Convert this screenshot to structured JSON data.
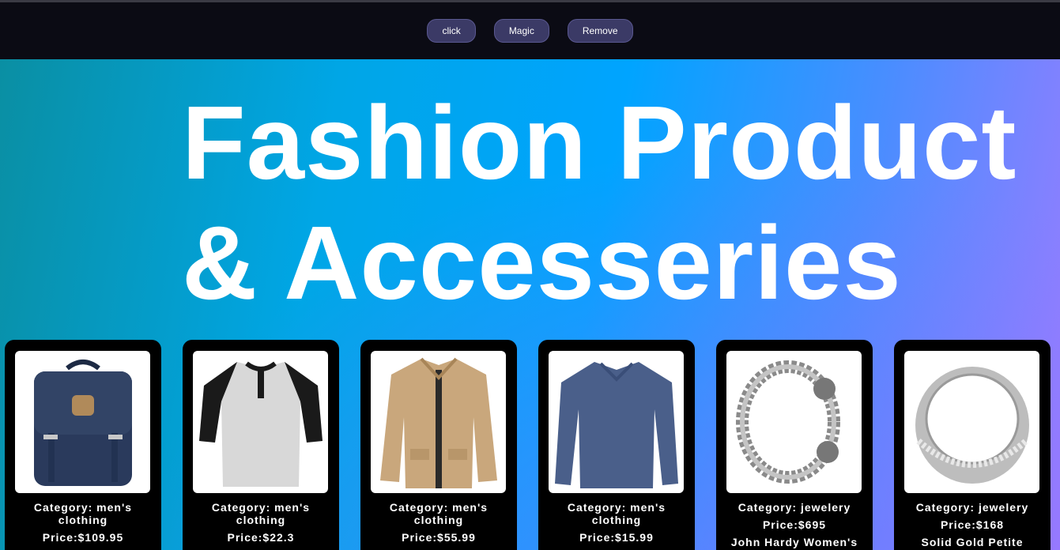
{
  "toolbar": {
    "buttons": [
      "click",
      "Magic",
      "Remove"
    ]
  },
  "hero": {
    "title_line1": "Fashion Product",
    "title_line2": "& Accesseries"
  },
  "products": [
    {
      "icon": "backpack-image",
      "category": "Category: men's clothing",
      "price": "Price:$109.95",
      "name": ""
    },
    {
      "icon": "henley-shirt-image",
      "category": "Category: men's clothing",
      "price": "Price:$22.3",
      "name": ""
    },
    {
      "icon": "jacket-image",
      "category": "Category: men's clothing",
      "price": "Price:$55.99",
      "name": ""
    },
    {
      "icon": "long-sleeve-tee-image",
      "category": "Category: men's clothing",
      "price": "Price:$15.99",
      "name": ""
    },
    {
      "icon": "bracelet-image",
      "category": "Category: jewelery",
      "price": "Price:$695",
      "name": "John Hardy Women's"
    },
    {
      "icon": "ring-image",
      "category": "Category: jewelery",
      "price": "Price:$168",
      "name": "Solid Gold Petite"
    }
  ],
  "colors": {
    "topbar": "#0b0b14",
    "button_bg": "#3b3a66",
    "card_bg": "#000000",
    "title": "#ffffff"
  }
}
